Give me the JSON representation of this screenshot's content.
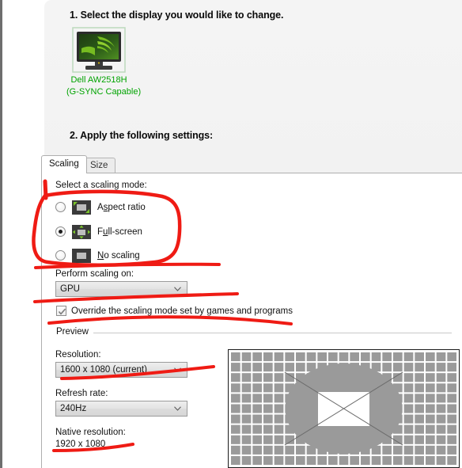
{
  "steps": {
    "step1": "1. Select the display you would like to change.",
    "step2": "2. Apply the following settings:"
  },
  "display": {
    "name": "Dell AW2518H",
    "capability": "(G-SYNC Capable)",
    "label_color": "#00a300",
    "icon": "monitor-nvidia-icon"
  },
  "tabs": [
    {
      "label": "Scaling",
      "active": true
    },
    {
      "label": "Size",
      "active": false
    }
  ],
  "scaling": {
    "section_label": "Select a scaling mode:",
    "modes": [
      {
        "label_pre": "A",
        "label_accel": "s",
        "label_post": "pect ratio",
        "full": "Aspect ratio",
        "selected": false,
        "icon": "aspect-ratio-icon"
      },
      {
        "label_pre": "F",
        "label_accel": "u",
        "label_post": "ll-screen",
        "full": "Full-screen",
        "selected": true,
        "icon": "full-screen-icon"
      },
      {
        "label_pre": "",
        "label_accel": "N",
        "label_post": "o scaling",
        "full": "No scaling",
        "selected": false,
        "icon": "no-scaling-icon"
      }
    ],
    "perform_label": "Perform scaling on:",
    "perform_value": "GPU",
    "override_label": "Override the scaling mode set by games and programs",
    "override_checked": true
  },
  "preview": {
    "group_label": "Preview",
    "resolution_label": "Resolution:",
    "resolution_value": "1600 x 1080 (current)",
    "refresh_label": "Refresh rate:",
    "refresh_value": "240Hz",
    "native_label": "Native resolution:",
    "native_value": "1920 x 1080"
  },
  "annotations": {
    "color": "#ef1b14",
    "marks": [
      "circle-around-scaling-modes",
      "underline-perform-scaling-on",
      "underline-override-checkbox",
      "underline-resolution-combo",
      "underline-native-resolution"
    ]
  }
}
